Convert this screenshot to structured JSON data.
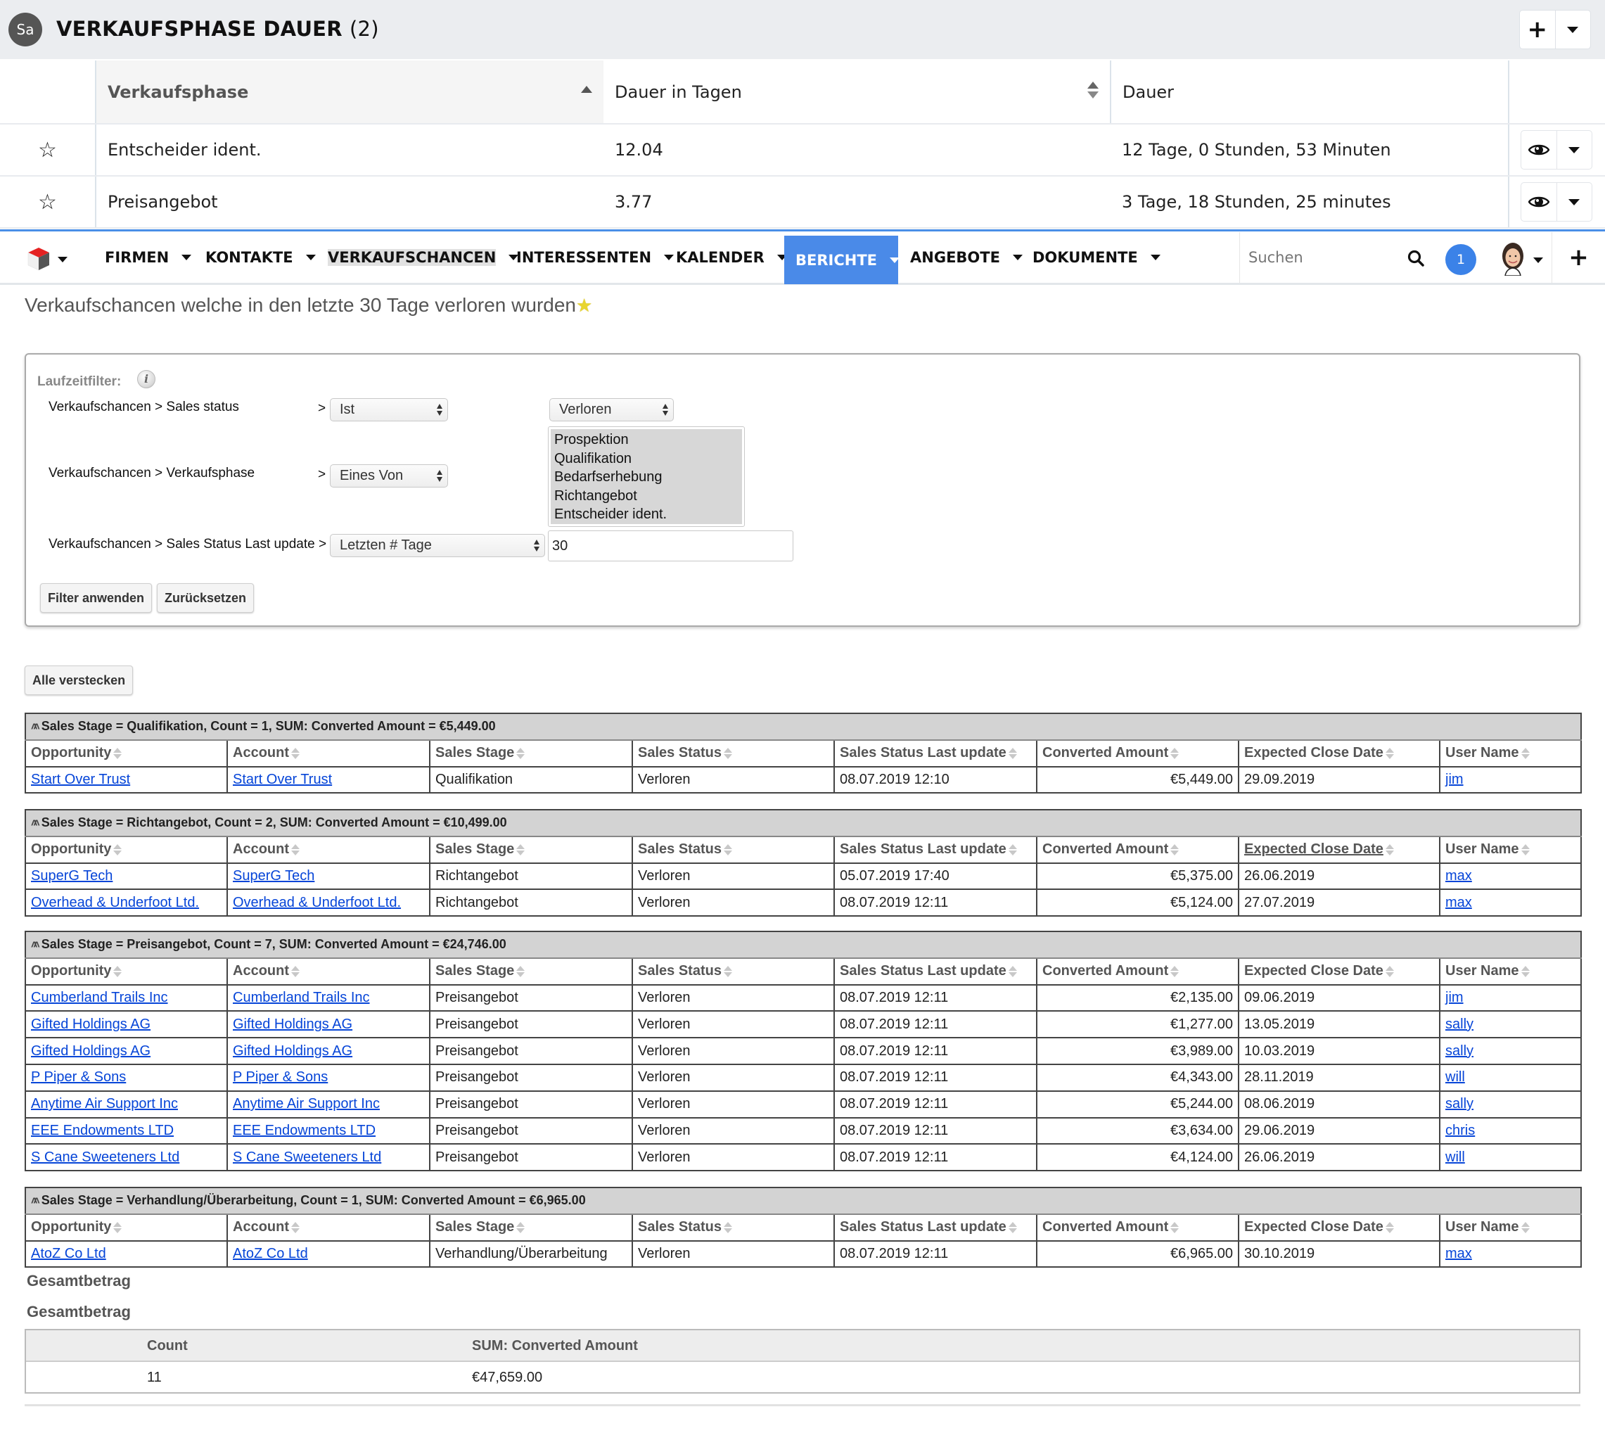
{
  "subpanel": {
    "avatar_initials": "Sa",
    "title": "VERKAUFSPHASE DAUER",
    "count": "(2)",
    "columns": [
      "Verkaufsphase",
      "Dauer in Tagen",
      "Dauer"
    ],
    "rows": [
      {
        "phase": "Entscheider ident.",
        "days": "12.04",
        "duration": "12 Tage, 0 Stunden, 53 Minuten"
      },
      {
        "phase": "Preisangebot",
        "days": "3.77",
        "duration": "3 Tage, 18 Stunden, 25 minutes"
      }
    ]
  },
  "navbar": {
    "items": [
      {
        "label": "FIRMEN"
      },
      {
        "label": "KONTAKTE"
      },
      {
        "label": "VERKAUFSCHANCEN"
      },
      {
        "label": "INTERESSENTEN"
      },
      {
        "label": "KALENDER"
      },
      {
        "label": "BERICHTE"
      },
      {
        "label": "ANGEBOTE"
      },
      {
        "label": "DOKUMENTE"
      }
    ],
    "active_item": "BERICHTE",
    "current_module": "VERKAUFSCHANCEN",
    "search_placeholder": "Suchen",
    "notification_count": "1",
    "accent_color": "#4a8ae8"
  },
  "report": {
    "title": "Verkaufschancen welche in den letzte 30 Tage verloren wurden",
    "title_icon": "favorite-star-icon"
  },
  "filters": {
    "caption": "Laufzeitfilter:",
    "rows": [
      {
        "label": "Verkaufschancen > Sales status",
        "operator": "Ist",
        "value": "Verloren"
      },
      {
        "label": "Verkaufschancen > Verkaufsphase",
        "operator": "Eines Von",
        "options": [
          "Prospektion",
          "Qualifikation",
          "Bedarfserhebung",
          "Richtangebot",
          "Entscheider ident."
        ]
      },
      {
        "label": "Verkaufschancen > Sales Status Last update >",
        "operator": "Letzten # Tage",
        "value": "30"
      }
    ],
    "apply_label": "Filter anwenden",
    "reset_label": "Zurücksetzen"
  },
  "hide_all_label": "Alle verstecken",
  "columns": [
    "Opportunity",
    "Account",
    "Sales Stage",
    "Sales Status",
    "Sales Status Last update",
    "Converted Amount",
    "Expected Close Date",
    "User Name"
  ],
  "groups": [
    {
      "header": "Sales Stage = Qualifikation, Count = 1, SUM: Converted Amount = €5,449.00",
      "rows": [
        [
          "Start Over Trust",
          "Start Over Trust",
          "Qualifikation",
          "Verloren",
          "08.07.2019 12:10",
          "€5,449.00",
          "29.09.2019",
          "jim"
        ]
      ]
    },
    {
      "header": "Sales Stage = Richtangebot, Count = 2, SUM: Converted Amount = €10,499.00",
      "rows": [
        [
          "SuperG Tech",
          "SuperG Tech",
          "Richtangebot",
          "Verloren",
          "05.07.2019 17:40",
          "€5,375.00",
          "26.06.2019",
          "max"
        ],
        [
          "Overhead & Underfoot Ltd.",
          "Overhead & Underfoot Ltd.",
          "Richtangebot",
          "Verloren",
          "08.07.2019 12:11",
          "€5,124.00",
          "27.07.2019",
          "max"
        ]
      ]
    },
    {
      "header": "Sales Stage = Preisangebot, Count = 7, SUM: Converted Amount = €24,746.00",
      "rows": [
        [
          "Cumberland Trails Inc",
          "Cumberland Trails Inc",
          "Preisangebot",
          "Verloren",
          "08.07.2019 12:11",
          "€2,135.00",
          "09.06.2019",
          "jim"
        ],
        [
          "Gifted Holdings AG",
          "Gifted Holdings AG",
          "Preisangebot",
          "Verloren",
          "08.07.2019 12:11",
          "€1,277.00",
          "13.05.2019",
          "sally"
        ],
        [
          "Gifted Holdings AG",
          "Gifted Holdings AG",
          "Preisangebot",
          "Verloren",
          "08.07.2019 12:11",
          "€3,989.00",
          "10.03.2019",
          "sally"
        ],
        [
          "P Piper & Sons",
          "P Piper & Sons",
          "Preisangebot",
          "Verloren",
          "08.07.2019 12:11",
          "€4,343.00",
          "28.11.2019",
          "will"
        ],
        [
          "Anytime Air Support Inc",
          "Anytime Air Support Inc",
          "Preisangebot",
          "Verloren",
          "08.07.2019 12:11",
          "€5,244.00",
          "08.06.2019",
          "sally"
        ],
        [
          "EEE Endowments LTD",
          "EEE Endowments LTD",
          "Preisangebot",
          "Verloren",
          "08.07.2019 12:11",
          "€3,634.00",
          "29.06.2019",
          "chris"
        ],
        [
          "S Cane Sweeteners Ltd",
          "S Cane Sweeteners Ltd",
          "Preisangebot",
          "Verloren",
          "08.07.2019 12:11",
          "€4,124.00",
          "26.06.2019",
          "will"
        ]
      ]
    },
    {
      "header": "Sales Stage = Verhandlung/Überarbeitung, Count = 1, SUM: Converted Amount = €6,965.00",
      "rows": [
        [
          "AtoZ Co Ltd",
          "AtoZ Co Ltd",
          "Verhandlung/Überarbeitung",
          "Verloren",
          "08.07.2019 12:11",
          "€6,965.00",
          "30.10.2019",
          "max"
        ]
      ]
    }
  ],
  "totals": {
    "label_1": "Gesamtbetrag",
    "label_2": "Gesamtbetrag",
    "headers": [
      "Count",
      "SUM: Converted Amount"
    ],
    "values": [
      "11",
      "€47,659.00"
    ]
  }
}
